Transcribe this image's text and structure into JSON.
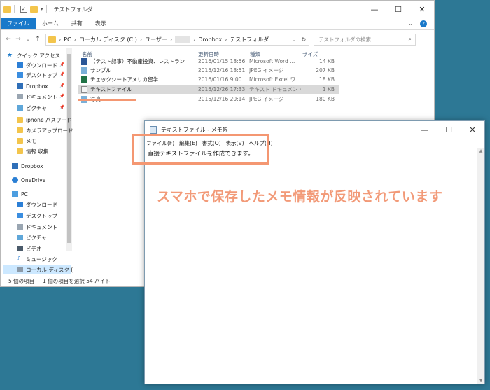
{
  "explorer": {
    "title": "テストフォルダ",
    "window_buttons": {
      "minimize": "—",
      "maximize": "☐",
      "close": "✕"
    },
    "ribbon_tabs": [
      "ファイル",
      "ホーム",
      "共有",
      "表示"
    ],
    "address": {
      "segments": [
        "PC",
        "ローカル ディスク (C:)",
        "ユーザー",
        "Dropbox",
        "テストフォルダ"
      ]
    },
    "search_placeholder": "テストフォルダの検索",
    "nav_items": [
      {
        "label": "クイック アクセス",
        "icon": "star-icon",
        "pinned": false
      },
      {
        "label": "ダウンロード",
        "icon": "download-icon",
        "pinned": true
      },
      {
        "label": "デスクトップ",
        "icon": "desktop-icon",
        "pinned": true
      },
      {
        "label": "Dropbox",
        "icon": "dropbox-icon",
        "pinned": true
      },
      {
        "label": "ドキュメント",
        "icon": "document-icon",
        "pinned": true
      },
      {
        "label": "ピクチャ",
        "icon": "picture-icon",
        "pinned": true
      },
      {
        "label": "iphone パスワード",
        "icon": "folder-icon",
        "pinned": false
      },
      {
        "label": "カメラアップロード",
        "icon": "folder-icon",
        "pinned": false
      },
      {
        "label": "メモ",
        "icon": "folder-icon",
        "pinned": false
      },
      {
        "label": "情報 収集",
        "icon": "folder-icon",
        "pinned": false
      },
      {
        "label": "Dropbox",
        "icon": "dropbox-icon",
        "pinned": false
      },
      {
        "label": "OneDrive",
        "icon": "onedrive-icon",
        "pinned": false
      },
      {
        "label": "PC",
        "icon": "pc-icon",
        "pinned": false
      },
      {
        "label": "ダウンロード",
        "icon": "download-icon",
        "pinned": false
      },
      {
        "label": "デスクトップ",
        "icon": "desktop-icon",
        "pinned": false
      },
      {
        "label": "ドキュメント",
        "icon": "document-icon",
        "pinned": false
      },
      {
        "label": "ピクチャ",
        "icon": "picture-icon",
        "pinned": false
      },
      {
        "label": "ビデオ",
        "icon": "video-icon",
        "pinned": false
      },
      {
        "label": "ミュージック",
        "icon": "music-icon",
        "pinned": false
      },
      {
        "label": "ローカル ディスク (C",
        "icon": "disk-icon",
        "pinned": false
      }
    ],
    "columns": {
      "name": "名前",
      "date": "更新日時",
      "type": "種類",
      "size": "サイズ"
    },
    "files": [
      {
        "name": "（テスト記事）不動産投資、レストラン",
        "date": "2016/01/15 18:56",
        "type": "Microsoft Word ...",
        "size": "14 KB",
        "icon": "word-icon"
      },
      {
        "name": "サンプル",
        "date": "2015/12/16 18:51",
        "type": "JPEG イメージ",
        "size": "207 KB",
        "icon": "image-icon"
      },
      {
        "name": "チェックシートアメリカ留学",
        "date": "2016/01/16 9:00",
        "type": "Microsoft Excel ワ...",
        "size": "18 KB",
        "icon": "excel-icon"
      },
      {
        "name": "テキストファイル",
        "date": "2015/12/26 17:33",
        "type": "テキスト ドキュメント",
        "size": "1 KB",
        "icon": "text-icon"
      },
      {
        "name": "写真",
        "date": "2015/12/16 20:14",
        "type": "JPEG イメージ",
        "size": "180 KB",
        "icon": "image-icon"
      }
    ],
    "status": {
      "count": "5 個の項目",
      "selected": "1 個の項目を選択  54 バイト"
    }
  },
  "notepad": {
    "title": "テキストファイル - メモ帳",
    "window_buttons": {
      "minimize": "—",
      "maximize": "☐",
      "close": "✕"
    },
    "menu": [
      "ファイル(F)",
      "編集(E)",
      "書式(O)",
      "表示(V)",
      "ヘルプ(H)"
    ],
    "content": "直接テキストファイルを作成できます。"
  },
  "annotation": "スマホで保存したメモ情報が反映されています",
  "colors": {
    "desktop": "#2d7895",
    "accent": "#1979ca",
    "highlight": "#f49772"
  }
}
